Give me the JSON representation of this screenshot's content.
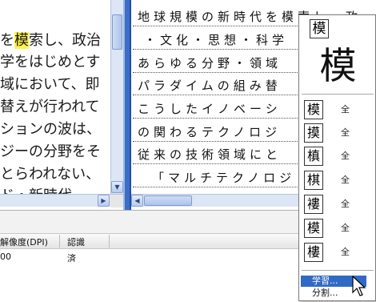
{
  "left_pane": {
    "lines": [
      {
        "before": "を",
        "highlight": "模",
        "after": "索し、政治"
      },
      {
        "before": "学をはじめとす",
        "highlight": "",
        "after": ""
      },
      {
        "before": "域において、即",
        "highlight": "",
        "after": ""
      },
      {
        "before": "替えが行われて",
        "highlight": "",
        "after": ""
      },
      {
        "before": "ションの波は、",
        "highlight": "",
        "after": ""
      },
      {
        "before": "ジーの分野をそ",
        "highlight": "",
        "after": ""
      },
      {
        "before": "とらわれない、",
        "highlight": "",
        "after": ""
      },
      {
        "before": "ド・新時代",
        "highlight": "",
        "after": ""
      }
    ]
  },
  "right_pane": {
    "lines": [
      "地球規模の新時代を模索し、政",
      "・文化・思想・科学",
      "あらゆる分野・領域",
      "パラダイムの組み替",
      "こうしたイノベーシ",
      "の関わるテクノロジ",
      "従来の技術領域にと",
      "「マルチテクノロジ"
    ]
  },
  "bottom_panel": {
    "headers": [
      "解像度(DPI)",
      "認識"
    ],
    "row": [
      "00",
      "済"
    ]
  },
  "candidate_popup": {
    "current": "模",
    "preview": "模",
    "candidates": [
      {
        "char": "模",
        "tag": "全"
      },
      {
        "char": "摸",
        "tag": "全"
      },
      {
        "char": "槙",
        "tag": "全"
      },
      {
        "char": "棋",
        "tag": "全"
      },
      {
        "char": "褸",
        "tag": "全"
      },
      {
        "char": "模",
        "tag": "全"
      },
      {
        "char": "樓",
        "tag": "全"
      }
    ],
    "menu": [
      "学習...",
      "分割..."
    ]
  },
  "colors": {
    "highlight": "#fff34d",
    "menu_selected": "#316ac5",
    "scrollbar": "#dce6f5"
  }
}
